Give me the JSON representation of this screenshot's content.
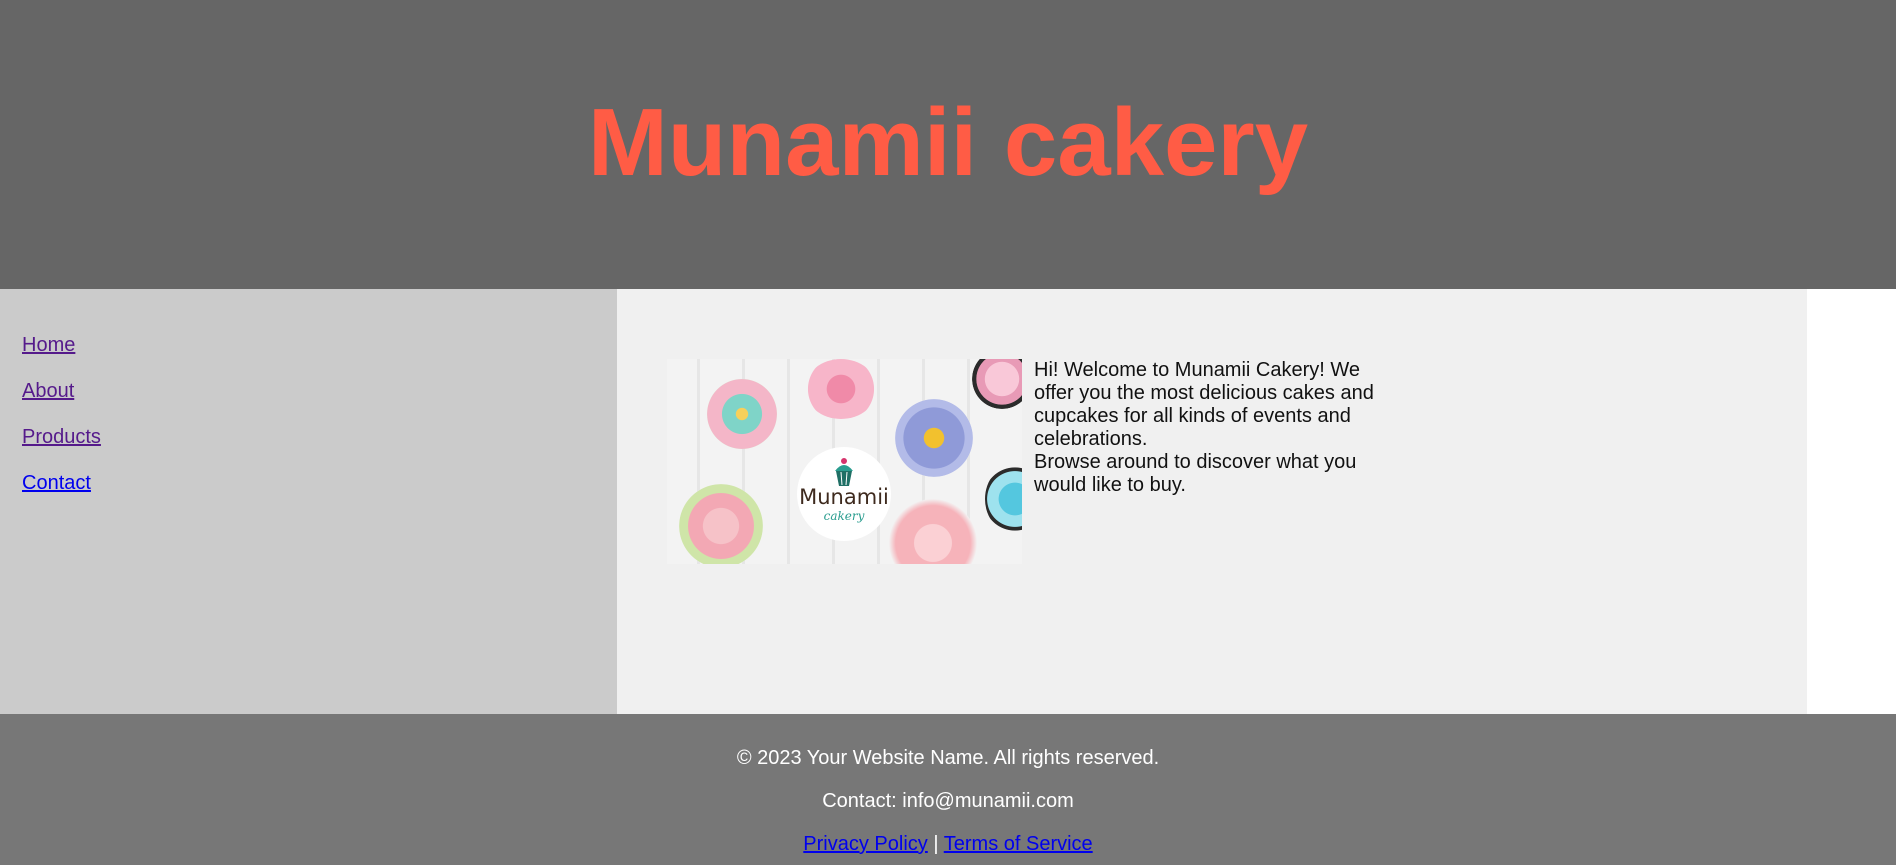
{
  "header": {
    "title": "Munamii cakery"
  },
  "nav": {
    "items": [
      {
        "label": "Home",
        "visited": true
      },
      {
        "label": "About",
        "visited": true
      },
      {
        "label": "Products",
        "visited": true
      },
      {
        "label": "Contact",
        "visited": false
      }
    ]
  },
  "main": {
    "hero_image": {
      "logo_text": "Munamii",
      "logo_subtext": "cakery"
    },
    "intro_paragraphs": [
      "Hi! Welcome to Munamii Cakery! We offer you the most delicious cakes and cupcakes for all kinds of events and celebrations.",
      "Browse around to discover what you would like to buy."
    ]
  },
  "footer": {
    "copyright": "© 2023 Your Website Name. All rights reserved.",
    "contact": "Contact: info@munamii.com",
    "privacy_label": "Privacy Policy",
    "separator": "|",
    "terms_label": "Terms of Service"
  },
  "colors": {
    "header_bg": "#666666",
    "title": "#ff5c45",
    "sidebar_bg": "#cbcbcb",
    "main_bg": "#f0f0f0",
    "footer_bg": "#777777",
    "link_visited": "#551a8b",
    "link_unvisited": "#0000ee"
  }
}
